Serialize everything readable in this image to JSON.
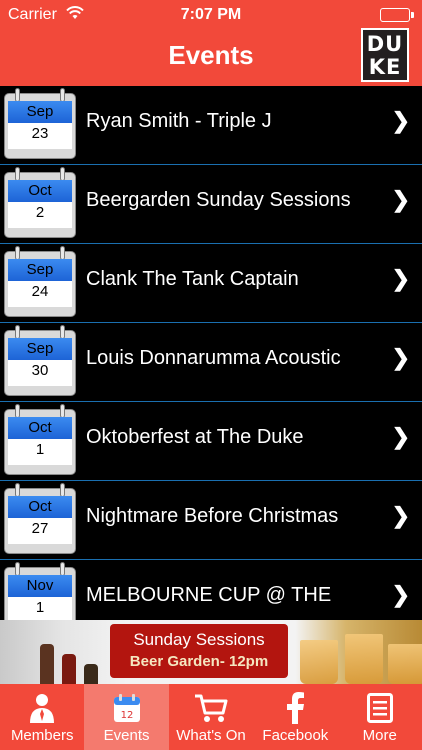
{
  "status_bar": {
    "carrier": "Carrier",
    "time": "7:07 PM"
  },
  "nav": {
    "title": "Events",
    "logo_text": "DUKE"
  },
  "events": [
    {
      "month": "Sep",
      "day": "23",
      "title": "Ryan Smith - Triple J"
    },
    {
      "month": "Oct",
      "day": "2",
      "title": "Beergarden Sunday Sessions"
    },
    {
      "month": "Sep",
      "day": "24",
      "title": "Clank The Tank Captain"
    },
    {
      "month": "Sep",
      "day": "30",
      "title": "Louis Donnarumma Acoustic"
    },
    {
      "month": "Oct",
      "day": "1",
      "title": "Oktoberfest at The Duke"
    },
    {
      "month": "Oct",
      "day": "27",
      "title": "Nightmare Before Christmas"
    },
    {
      "month": "Nov",
      "day": "1",
      "title": "MELBOURNE CUP @ THE"
    }
  ],
  "banner": {
    "line1": "Sunday Sessions",
    "line2": "Beer Garden- 12pm"
  },
  "tabs": [
    {
      "label": "Members",
      "icon": "members-icon"
    },
    {
      "label": "Events",
      "icon": "calendar-icon",
      "active": true
    },
    {
      "label": "What's On",
      "icon": "cart-icon"
    },
    {
      "label": "Facebook",
      "icon": "facebook-icon"
    },
    {
      "label": "More",
      "icon": "more-list-icon"
    }
  ],
  "colors": {
    "brand_red": "#f2493a",
    "active_tab": "#f47a6e",
    "list_bg": "#000000",
    "divider_blue": "#1a6fb0"
  }
}
